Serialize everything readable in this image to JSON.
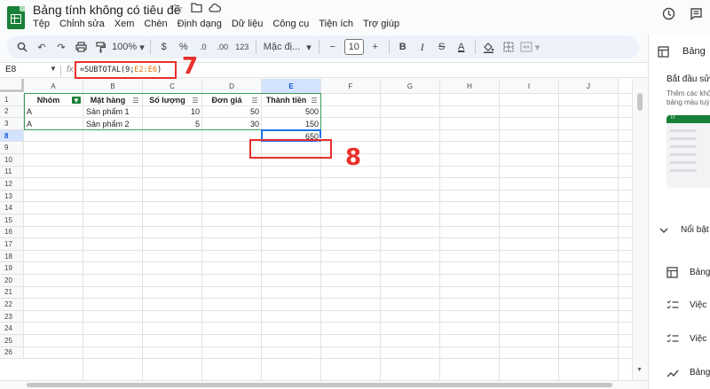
{
  "header": {
    "title": "Bảng tính không có tiêu đề",
    "menu": [
      "Tệp",
      "Chỉnh sửa",
      "Xem",
      "Chèn",
      "Định dạng",
      "Dữ liệu",
      "Công cụ",
      "Tiện ích",
      "Trợ giúp"
    ]
  },
  "toolbar": {
    "zoom": "100%",
    "currency": "$",
    "percent": "%",
    "decimal_decrease": ".0",
    "decimal_increase": ".00",
    "number_format": "123",
    "font": "Mặc đị...",
    "minus": "−",
    "font_size": "10",
    "plus": "+",
    "bold": "B",
    "italic": "I",
    "strike": "S",
    "text_color": "A"
  },
  "formula_bar": {
    "cell_ref": "E8",
    "fx": "fx",
    "formula_prefix": "=SUBTOTAL(9;",
    "formula_range": "E2:E6",
    "formula_suffix": ")"
  },
  "grid": {
    "columns": [
      "A",
      "B",
      "C",
      "D",
      "E",
      "F",
      "G",
      "H",
      "I",
      "J"
    ],
    "rows": [
      "1",
      "2",
      "3",
      "8",
      "9",
      "10",
      "11",
      "12",
      "13",
      "14",
      "15",
      "16",
      "17",
      "18",
      "19",
      "20",
      "21",
      "22",
      "23",
      "24",
      "25",
      "26"
    ],
    "headers": [
      "Nhóm",
      "Mặt hàng",
      "Số lượng",
      "Đơn giá",
      "Thành tiền"
    ],
    "data": [
      [
        "A",
        "Sản phẩm 1",
        "10",
        "50",
        "500"
      ],
      [
        "A",
        "Sản phẩm 2",
        "5",
        "30",
        "150"
      ]
    ],
    "total": "650"
  },
  "annotations": {
    "step7": "7",
    "step8": "8"
  },
  "side_panel": {
    "title": "Bảng",
    "start": "Bắt đầu sử",
    "desc1": "Thêm các khố",
    "desc2": "bảng màu tuỳ",
    "card_label": "Tr",
    "section": "Nổi bật",
    "items": [
      "Bảng",
      "Việc",
      "Việc",
      "Bảng"
    ]
  },
  "colors": {
    "accent": "#1a73e8",
    "brand": "#188038",
    "annotation": "#e8302b",
    "formula_range": "#e37400"
  }
}
